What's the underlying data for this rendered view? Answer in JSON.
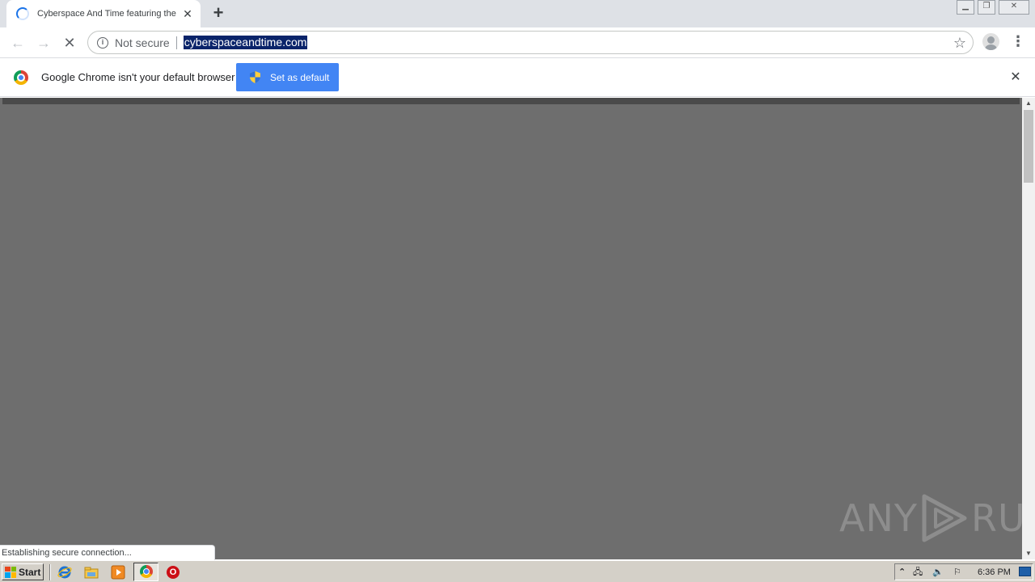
{
  "tab": {
    "title": "Cyberspace And Time featuring the"
  },
  "toolbar": {
    "security_label": "Not secure",
    "url": "cyberspaceandtime.com"
  },
  "infobar": {
    "message": "Google Chrome isn't your default browser",
    "button_label": "Set as default"
  },
  "content": {
    "background_color": "#6e6e6e",
    "watermark_left": "ANY",
    "watermark_right": "RUN"
  },
  "status": {
    "text": "Establishing secure connection..."
  },
  "taskbar": {
    "start_label": "Start",
    "clock": "6:36 PM"
  },
  "colors": {
    "accent": "#4285f4",
    "url_highlight": "#0a246a"
  }
}
